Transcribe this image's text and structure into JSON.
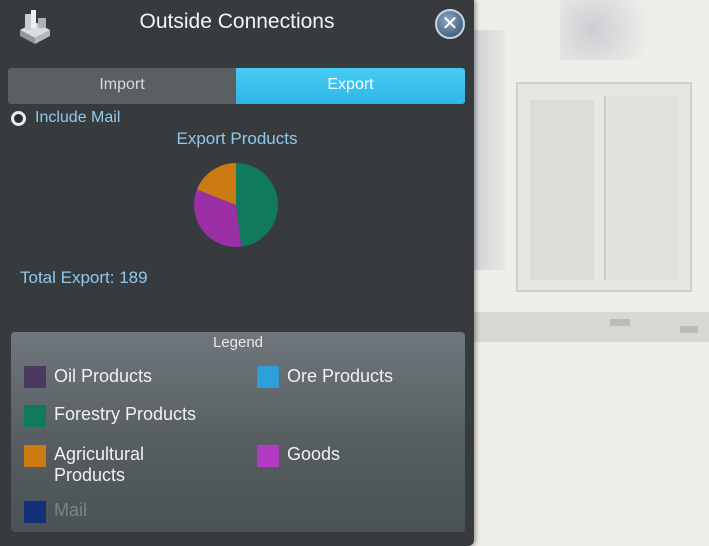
{
  "window": {
    "title": "Outside Connections",
    "close_label": "✕"
  },
  "tabs": [
    {
      "label": "Import",
      "active": false
    },
    {
      "label": "Export",
      "active": true
    }
  ],
  "include_mail": {
    "label": "Include Mail",
    "checked": false
  },
  "section_title": "Export Products",
  "total_export": "Total Export: 189",
  "chart_data": {
    "type": "pie",
    "title": "Export Products",
    "slices": [
      {
        "name": "Forestry Products",
        "value": 48,
        "color": "#117a5b"
      },
      {
        "name": "Goods",
        "value": 33,
        "color": "#9a2fa6"
      },
      {
        "name": "Agricultural Products",
        "value": 19,
        "color": "#cc7a12"
      }
    ]
  },
  "legend": {
    "title": "Legend",
    "items": [
      {
        "label": "Oil Products",
        "color": "#4a3a62"
      },
      {
        "label": "Ore Products",
        "color": "#2e9fd8"
      },
      {
        "label": "Forestry Products",
        "color": "#117a5b"
      },
      {
        "label": "Agricultural Products",
        "color": "#cc7a12"
      },
      {
        "label": "Goods",
        "color": "#b33ac2"
      },
      {
        "label": "Mail",
        "color": "#12307a",
        "disabled": true
      }
    ]
  },
  "colors": {
    "panel": "#373b3d",
    "accent": "#39c3ef",
    "text_blue": "#8ecaf0"
  },
  "icons": {
    "app": "industry-building-icon",
    "close": "close-icon"
  }
}
